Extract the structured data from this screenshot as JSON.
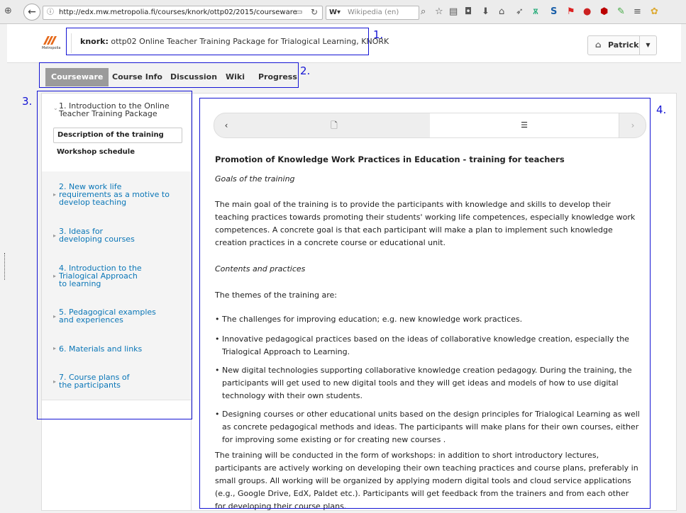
{
  "browser": {
    "url": "http://edx.mw.metropolia.fi/courses/knork/ottp02/2015/courseware",
    "search_placeholder": "Wikipedia (en)",
    "search_engine_label": "W▾"
  },
  "header": {
    "logo_text": "Metropolia",
    "course_org": "knork:",
    "course_title": "ottp02 Online Teacher Training Package for Trialogical Learning, KNORK",
    "user_name": "Patrick"
  },
  "tabs": [
    {
      "label": "Courseware",
      "active": true
    },
    {
      "label": "Course Info"
    },
    {
      "label": "Discussion"
    },
    {
      "label": "Wiki"
    },
    {
      "label": "Progress"
    }
  ],
  "sidebar": {
    "chapters": [
      {
        "lines": [
          "1. Introduction to the Online",
          "Teacher Training Package"
        ],
        "sections": [
          "Description of the training",
          "Workshop schedule"
        ]
      },
      {
        "lines": [
          "2. New work life",
          "requirements as a motive to",
          "develop teaching"
        ]
      },
      {
        "lines": [
          "3. Ideas for",
          "developing courses"
        ]
      },
      {
        "lines": [
          "4. Introduction to the",
          "Trialogical Approach",
          "to learning"
        ]
      },
      {
        "lines": [
          "5. Pedagogical examples",
          "and experiences"
        ]
      },
      {
        "lines": [
          "6. Materials and links"
        ]
      },
      {
        "lines": [
          "7. Course plans of",
          "the participants"
        ]
      }
    ]
  },
  "content": {
    "heading": "Promotion of Knowledge Work Practices in Education - training for teachers",
    "goals_heading": "Goals of the training",
    "goals_text": "The main goal of the training is to provide the participants with knowledge and skills to develop their teaching practices towards promoting their students' working life competences, especially knowledge work competences. A concrete goal is that each participant will make a plan to implement such knowledge creation practices in a concrete course or educational unit.",
    "contents_heading": "Contents and practices",
    "themes_intro": "The themes of the training are:",
    "bullets": [
      "The challenges for improving education; e.g. new knowledge work practices.",
      "Innovative pedagogical practices based on the ideas of collaborative knowledge creation, especially the Trialogical Approach to Learning.",
      "New digital technologies supporting collaborative knowledge creation pedagogy. During the training, the participants will get used to new digital tools and they will get ideas and models of how to use digital technology with their own students.",
      "Designing courses or other educational units based on the design principles for Trialogical Learning as well as concrete pedagogical methods and ideas. The participants will make plans for their own courses, either for improving some existing or for creating new courses ."
    ],
    "closing_text": "The training will be conducted in the form of workshops: in addition to short introductory lectures, participants are actively working on developing their own teaching practices and course plans, preferably in small groups. All working will be organized by applying modern digital tools and cloud service applications (e.g., Google Drive, EdX, Paldet etc.). Participants will get feedback from the trainers and from each other for developing their course plans."
  },
  "annotations": [
    "1.",
    "2.",
    "3.",
    "4."
  ]
}
